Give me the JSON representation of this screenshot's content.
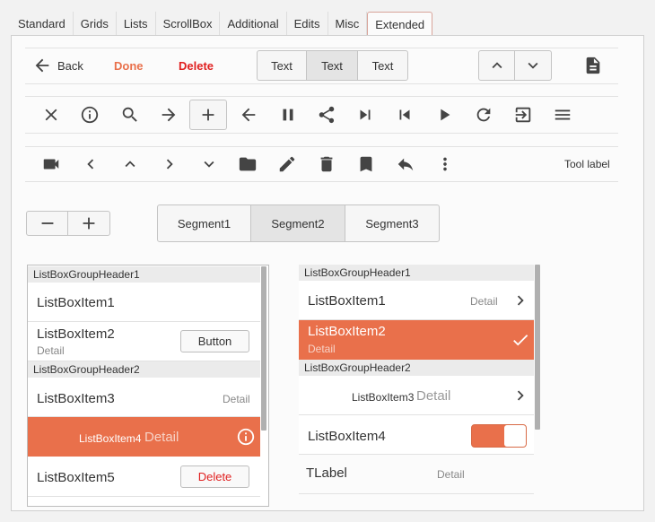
{
  "tabs": [
    "Standard",
    "Grids",
    "Lists",
    "ScrollBox",
    "Additional",
    "Edits",
    "Misc",
    "Extended"
  ],
  "toolbar1": {
    "back_label": "Back",
    "done_label": "Done",
    "delete_label": "Delete",
    "segments": [
      "Text",
      "Text",
      "Text"
    ]
  },
  "toolbar3": {
    "tool_label": "Tool label"
  },
  "segment_control": [
    "Segment1",
    "Segment2",
    "Segment3"
  ],
  "listbox_left": {
    "group1": "ListBoxGroupHeader1",
    "item1": "ListBoxItem1",
    "item2": "ListBoxItem2",
    "item2_detail": "Detail",
    "item2_button": "Button",
    "group2": "ListBoxGroupHeader2",
    "item3": "ListBoxItem3",
    "item3_detail": "Detail",
    "item4": "ListBoxItem4",
    "item4_detail": "Detail",
    "item5": "ListBoxItem5",
    "item5_button": "Delete"
  },
  "listbox_right": {
    "group1": "ListBoxGroupHeader1",
    "item1": "ListBoxItem1",
    "item1_detail": "Detail",
    "item2": "ListBoxItem2",
    "item2_detail": "Detail",
    "group2": "ListBoxGroupHeader2",
    "item3": "ListBoxItem3",
    "item3_detail": "Detail",
    "item4": "ListBoxItem4",
    "label": "TLabel",
    "label_detail": "Detail"
  },
  "colors": {
    "accent": "#e9704b",
    "delete": "#e02020",
    "done": "#e9704b"
  }
}
